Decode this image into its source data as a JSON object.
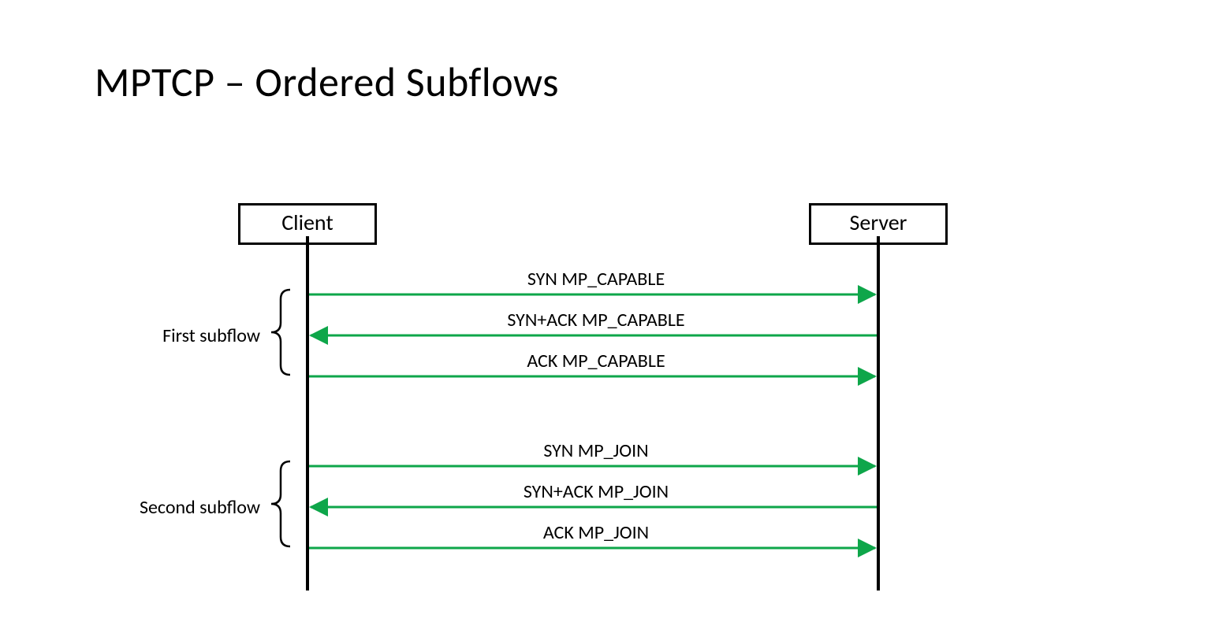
{
  "title": "MPTCP – Ordered Subflows",
  "participants": {
    "client": "Client",
    "server": "Server"
  },
  "groups": {
    "first": "First subflow",
    "second": "Second subflow"
  },
  "messages": {
    "m1": "SYN MP_CAPABLE",
    "m2": "SYN+ACK MP_CAPABLE",
    "m3": "ACK MP_CAPABLE",
    "m4": "SYN MP_JOIN",
    "m5": "SYN+ACK MP_JOIN",
    "m6": "ACK MP_JOIN"
  },
  "colors": {
    "arrow": "#0ea64a"
  },
  "chart_data": {
    "type": "sequence_diagram",
    "participants": [
      "Client",
      "Server"
    ],
    "groups": [
      {
        "label": "First subflow",
        "messages": [
          {
            "from": "Client",
            "to": "Server",
            "text": "SYN MP_CAPABLE"
          },
          {
            "from": "Server",
            "to": "Client",
            "text": "SYN+ACK MP_CAPABLE"
          },
          {
            "from": "Client",
            "to": "Server",
            "text": "ACK MP_CAPABLE"
          }
        ]
      },
      {
        "label": "Second subflow",
        "messages": [
          {
            "from": "Client",
            "to": "Server",
            "text": "SYN MP_JOIN"
          },
          {
            "from": "Server",
            "to": "Client",
            "text": "SYN+ACK MP_JOIN"
          },
          {
            "from": "Client",
            "to": "Server",
            "text": "ACK MP_JOIN"
          }
        ]
      }
    ]
  }
}
